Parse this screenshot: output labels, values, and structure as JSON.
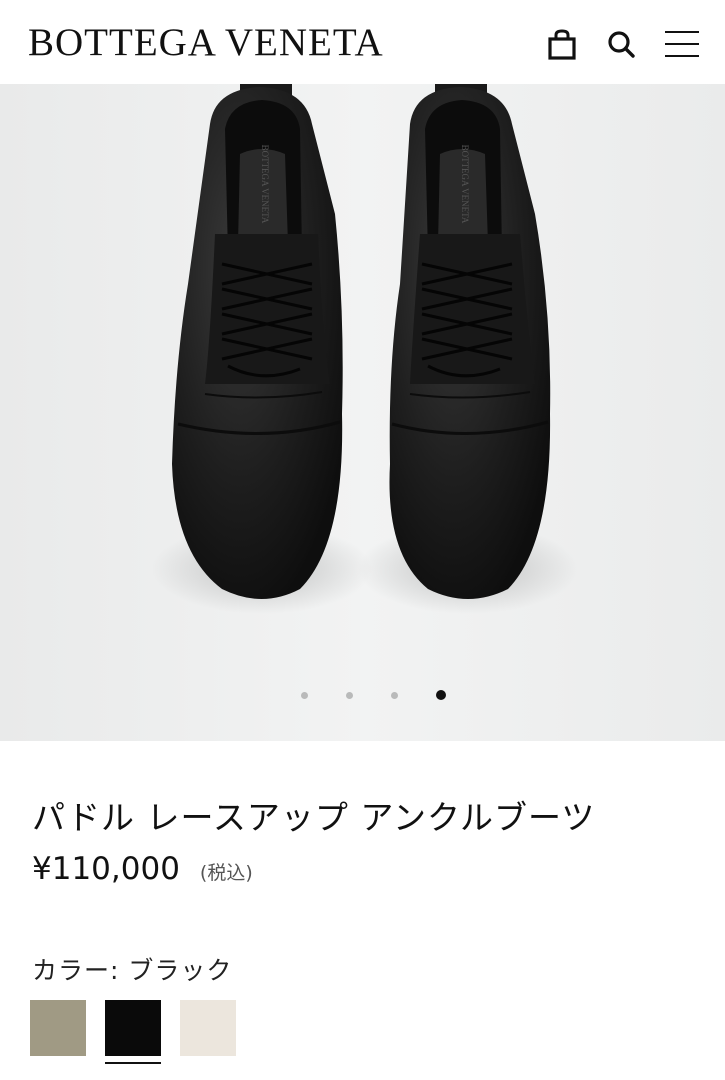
{
  "header": {
    "logo": "BOTTEGA VENETA",
    "icons": [
      "shopping-bag-icon",
      "search-icon",
      "menu-icon"
    ]
  },
  "gallery": {
    "slide_count": 4,
    "active_slide": 4,
    "insole_text": "BOTTEGA VENETA"
  },
  "product": {
    "title": "パドル レースアップ アンクルブーツ",
    "price": "¥110,000",
    "tax_note": "(税込)",
    "color_label": "カラー: ブラック",
    "swatches": [
      {
        "name": "taupe",
        "color": "#a09a84",
        "selected": false
      },
      {
        "name": "black",
        "color": "#0a0a0a",
        "selected": true
      },
      {
        "name": "cream",
        "color": "#ece6dd",
        "selected": false
      }
    ]
  },
  "colors": {
    "boot": "#1c1c1c",
    "background": "#eeefef"
  }
}
